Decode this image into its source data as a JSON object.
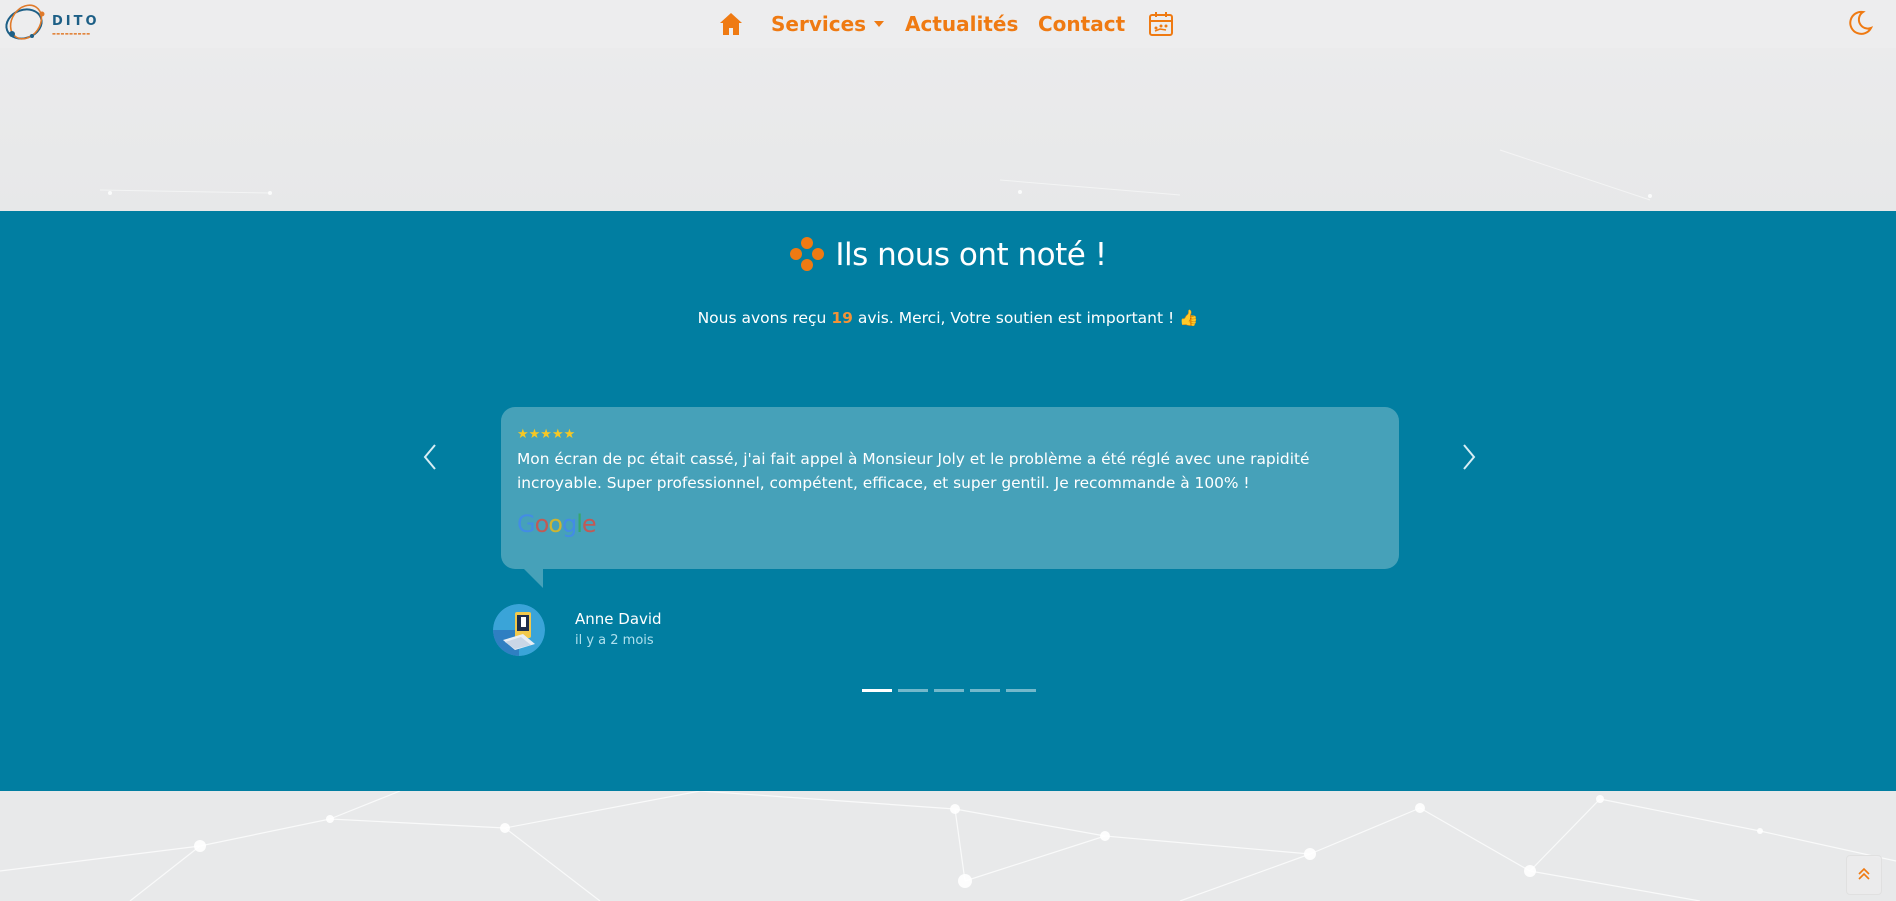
{
  "nav": {
    "logo_text": "DITO",
    "items": [
      {
        "label": "Services",
        "has_dropdown": true
      },
      {
        "label": "Actualités"
      },
      {
        "label": "Contact"
      }
    ],
    "icons": [
      "home-icon",
      "calendar-icon",
      "moon-icon"
    ]
  },
  "reviews": {
    "title": "Ils nous ont noté !",
    "subtitle_before": "Nous avons reçu ",
    "count": "19",
    "subtitle_after": " avis. Merci, Votre soutien est important ! 👍",
    "card": {
      "stars": "★★★★★",
      "rating": 5,
      "text": "Mon écran de pc était cassé, j'ai fait appel à Monsieur Joly et le problème a été réglé avec une rapidité incroyable. Super professionnel, compétent, efficace, et super gentil. Je recommande à 100% !",
      "source": "Google"
    },
    "author": "Anne David",
    "ago": "il y a 2 mois",
    "slides_total": 5,
    "active_slide": 1
  },
  "colors": {
    "accent": "#ef7a12",
    "section_bg": "#017ea1",
    "card_bg": "#46a1b9",
    "page_bg": "#e8e9ea"
  }
}
